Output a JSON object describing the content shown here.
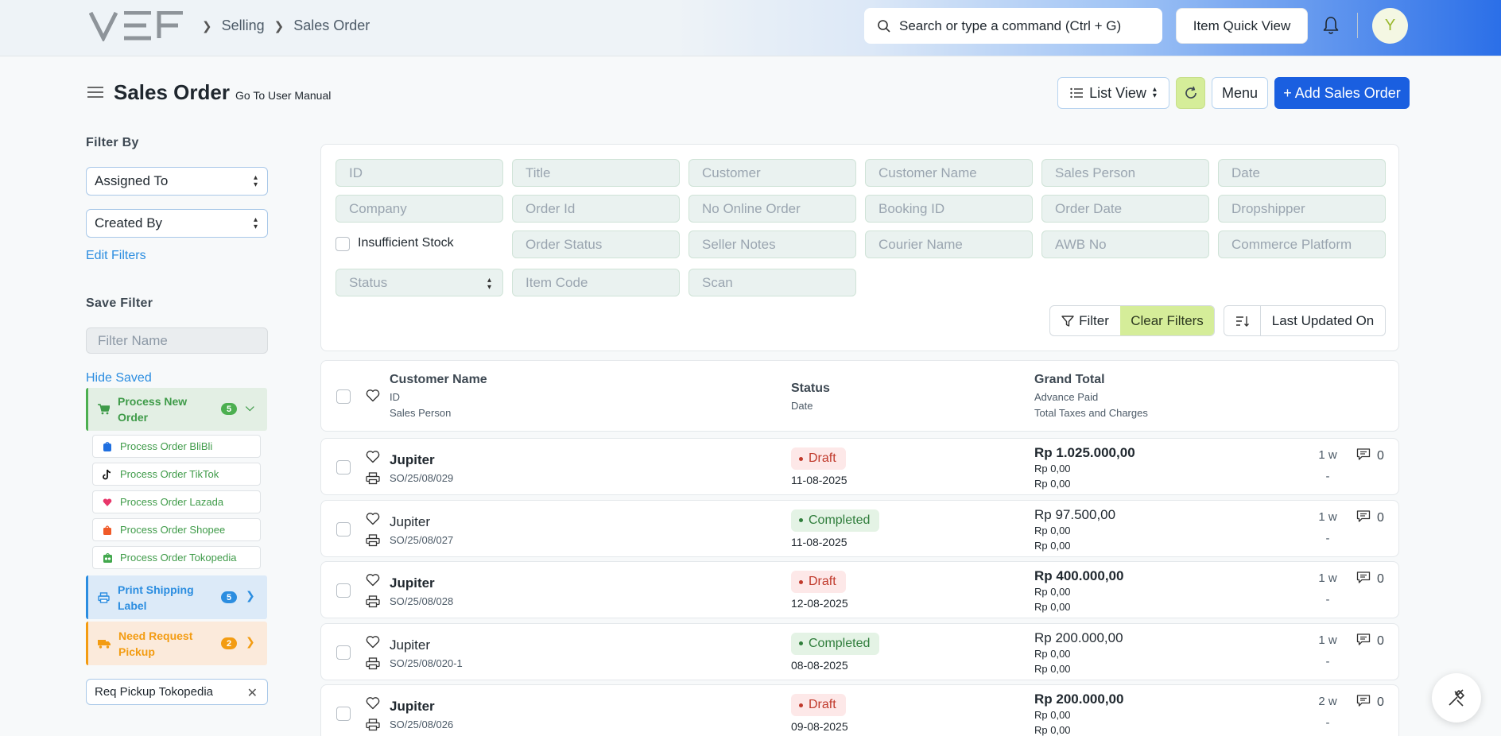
{
  "breadcrumb": [
    "Selling",
    "Sales Order"
  ],
  "search": {
    "placeholder": "Search or type a command (Ctrl + G)"
  },
  "header": {
    "item_quick_view": "Item Quick View",
    "avatar_initial": "Y"
  },
  "page": {
    "title": "Sales Order",
    "manual_link": "Go To User Manual"
  },
  "toolbar": {
    "list_view": "List View",
    "menu": "Menu",
    "add": "+ Add Sales Order"
  },
  "sidebar": {
    "filter_by": "Filter By",
    "assigned_to": "Assigned To",
    "created_by": "Created By",
    "edit_filters": "Edit Filters",
    "save_filter": "Save Filter",
    "filter_name_placeholder": "Filter Name",
    "hide_saved": "Hide Saved",
    "groups": [
      {
        "label": "Process New Order",
        "count": "5",
        "icon": "cart-icon",
        "color": "#4caf50"
      },
      {
        "label": "Print Shipping Label",
        "count": "5",
        "icon": "printer-icon",
        "color": "#2b8de0"
      },
      {
        "label": "Need Request Pickup",
        "count": "2",
        "icon": "truck-icon",
        "color": "#f39c12"
      }
    ],
    "subitems": [
      {
        "label": "Process Order BliBli",
        "icon": "blibli-icon"
      },
      {
        "label": "Process Order TikTok",
        "icon": "tiktok-icon"
      },
      {
        "label": "Process Order Lazada",
        "icon": "lazada-icon"
      },
      {
        "label": "Process Order Shopee",
        "icon": "shopee-icon"
      },
      {
        "label": "Process Order Tokopedia",
        "icon": "tokopedia-icon"
      }
    ],
    "req_pickup": "Req Pickup Tokopedia"
  },
  "filters": {
    "row1": [
      "ID",
      "Title",
      "Customer",
      "Customer Name",
      "Sales Person",
      "Date"
    ],
    "row2": [
      "Company",
      "Order Id",
      "No Online Order",
      "Booking ID",
      "Order Date",
      "Dropshipper"
    ],
    "insufficient_stock": "Insufficient Stock",
    "row3": [
      "Order Status",
      "Seller Notes",
      "Courier Name",
      "AWB No",
      "Commerce Platform"
    ],
    "status": "Status",
    "row4": [
      "Item Code",
      "Scan"
    ],
    "filter_btn": "Filter",
    "clear_btn": "Clear Filters",
    "sort_label": "Last Updated On"
  },
  "list_header": {
    "col1": "Customer Name",
    "col1_sub1": "ID",
    "col1_sub2": "Sales Person",
    "col2": "Status",
    "col2_sub": "Date",
    "col3": "Grand Total",
    "col3_sub1": "Advance Paid",
    "col3_sub2": "Total Taxes and Charges"
  },
  "rows": [
    {
      "customer": "Jupiter",
      "id": "SO/25/08/029",
      "status": "Draft",
      "date": "11-08-2025",
      "grand_total": "Rp 1.025.000,00",
      "advance": "Rp 0,00",
      "taxes": "Rp 0,00",
      "ago": "1 w",
      "dash": "-",
      "comments": "0"
    },
    {
      "customer": "Jupiter",
      "id": "SO/25/08/027",
      "status": "Completed",
      "date": "11-08-2025",
      "grand_total": "Rp 97.500,00",
      "advance": "Rp 0,00",
      "taxes": "Rp 0,00",
      "ago": "1 w",
      "dash": "-",
      "comments": "0"
    },
    {
      "customer": "Jupiter",
      "id": "SO/25/08/028",
      "status": "Draft",
      "date": "12-08-2025",
      "grand_total": "Rp 400.000,00",
      "advance": "Rp 0,00",
      "taxes": "Rp 0,00",
      "ago": "1 w",
      "dash": "-",
      "comments": "0"
    },
    {
      "customer": "Jupiter",
      "id": "SO/25/08/020-1",
      "status": "Completed",
      "date": "08-08-2025",
      "grand_total": "Rp 200.000,00",
      "advance": "Rp 0,00",
      "taxes": "Rp 0,00",
      "ago": "1 w",
      "dash": "-",
      "comments": "0"
    },
    {
      "customer": "Jupiter",
      "id": "SO/25/08/026",
      "status": "Draft",
      "date": "09-08-2025",
      "grand_total": "Rp 200.000,00",
      "advance": "Rp 0,00",
      "taxes": "Rp 0,00",
      "ago": "2 w",
      "dash": "-",
      "comments": "0"
    }
  ]
}
